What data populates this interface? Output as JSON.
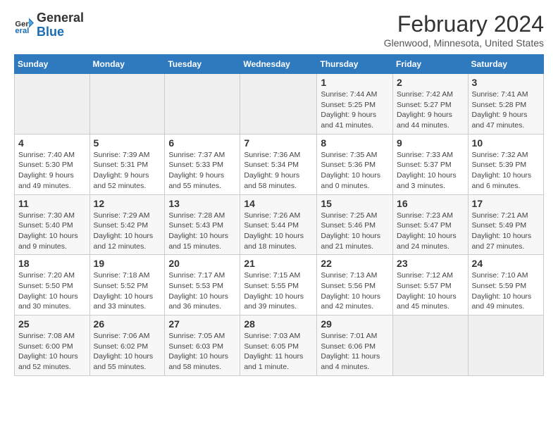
{
  "logo": {
    "text_general": "General",
    "text_blue": "Blue"
  },
  "title": "February 2024",
  "subtitle": "Glenwood, Minnesota, United States",
  "days_of_week": [
    "Sunday",
    "Monday",
    "Tuesday",
    "Wednesday",
    "Thursday",
    "Friday",
    "Saturday"
  ],
  "weeks": [
    [
      {
        "day": "",
        "info": ""
      },
      {
        "day": "",
        "info": ""
      },
      {
        "day": "",
        "info": ""
      },
      {
        "day": "",
        "info": ""
      },
      {
        "day": "1",
        "info": "Sunrise: 7:44 AM\nSunset: 5:25 PM\nDaylight: 9 hours\nand 41 minutes."
      },
      {
        "day": "2",
        "info": "Sunrise: 7:42 AM\nSunset: 5:27 PM\nDaylight: 9 hours\nand 44 minutes."
      },
      {
        "day": "3",
        "info": "Sunrise: 7:41 AM\nSunset: 5:28 PM\nDaylight: 9 hours\nand 47 minutes."
      }
    ],
    [
      {
        "day": "4",
        "info": "Sunrise: 7:40 AM\nSunset: 5:30 PM\nDaylight: 9 hours\nand 49 minutes."
      },
      {
        "day": "5",
        "info": "Sunrise: 7:39 AM\nSunset: 5:31 PM\nDaylight: 9 hours\nand 52 minutes."
      },
      {
        "day": "6",
        "info": "Sunrise: 7:37 AM\nSunset: 5:33 PM\nDaylight: 9 hours\nand 55 minutes."
      },
      {
        "day": "7",
        "info": "Sunrise: 7:36 AM\nSunset: 5:34 PM\nDaylight: 9 hours\nand 58 minutes."
      },
      {
        "day": "8",
        "info": "Sunrise: 7:35 AM\nSunset: 5:36 PM\nDaylight: 10 hours\nand 0 minutes."
      },
      {
        "day": "9",
        "info": "Sunrise: 7:33 AM\nSunset: 5:37 PM\nDaylight: 10 hours\nand 3 minutes."
      },
      {
        "day": "10",
        "info": "Sunrise: 7:32 AM\nSunset: 5:39 PM\nDaylight: 10 hours\nand 6 minutes."
      }
    ],
    [
      {
        "day": "11",
        "info": "Sunrise: 7:30 AM\nSunset: 5:40 PM\nDaylight: 10 hours\nand 9 minutes."
      },
      {
        "day": "12",
        "info": "Sunrise: 7:29 AM\nSunset: 5:42 PM\nDaylight: 10 hours\nand 12 minutes."
      },
      {
        "day": "13",
        "info": "Sunrise: 7:28 AM\nSunset: 5:43 PM\nDaylight: 10 hours\nand 15 minutes."
      },
      {
        "day": "14",
        "info": "Sunrise: 7:26 AM\nSunset: 5:44 PM\nDaylight: 10 hours\nand 18 minutes."
      },
      {
        "day": "15",
        "info": "Sunrise: 7:25 AM\nSunset: 5:46 PM\nDaylight: 10 hours\nand 21 minutes."
      },
      {
        "day": "16",
        "info": "Sunrise: 7:23 AM\nSunset: 5:47 PM\nDaylight: 10 hours\nand 24 minutes."
      },
      {
        "day": "17",
        "info": "Sunrise: 7:21 AM\nSunset: 5:49 PM\nDaylight: 10 hours\nand 27 minutes."
      }
    ],
    [
      {
        "day": "18",
        "info": "Sunrise: 7:20 AM\nSunset: 5:50 PM\nDaylight: 10 hours\nand 30 minutes."
      },
      {
        "day": "19",
        "info": "Sunrise: 7:18 AM\nSunset: 5:52 PM\nDaylight: 10 hours\nand 33 minutes."
      },
      {
        "day": "20",
        "info": "Sunrise: 7:17 AM\nSunset: 5:53 PM\nDaylight: 10 hours\nand 36 minutes."
      },
      {
        "day": "21",
        "info": "Sunrise: 7:15 AM\nSunset: 5:55 PM\nDaylight: 10 hours\nand 39 minutes."
      },
      {
        "day": "22",
        "info": "Sunrise: 7:13 AM\nSunset: 5:56 PM\nDaylight: 10 hours\nand 42 minutes."
      },
      {
        "day": "23",
        "info": "Sunrise: 7:12 AM\nSunset: 5:57 PM\nDaylight: 10 hours\nand 45 minutes."
      },
      {
        "day": "24",
        "info": "Sunrise: 7:10 AM\nSunset: 5:59 PM\nDaylight: 10 hours\nand 49 minutes."
      }
    ],
    [
      {
        "day": "25",
        "info": "Sunrise: 7:08 AM\nSunset: 6:00 PM\nDaylight: 10 hours\nand 52 minutes."
      },
      {
        "day": "26",
        "info": "Sunrise: 7:06 AM\nSunset: 6:02 PM\nDaylight: 10 hours\nand 55 minutes."
      },
      {
        "day": "27",
        "info": "Sunrise: 7:05 AM\nSunset: 6:03 PM\nDaylight: 10 hours\nand 58 minutes."
      },
      {
        "day": "28",
        "info": "Sunrise: 7:03 AM\nSunset: 6:05 PM\nDaylight: 11 hours\nand 1 minute."
      },
      {
        "day": "29",
        "info": "Sunrise: 7:01 AM\nSunset: 6:06 PM\nDaylight: 11 hours\nand 4 minutes."
      },
      {
        "day": "",
        "info": ""
      },
      {
        "day": "",
        "info": ""
      }
    ]
  ]
}
